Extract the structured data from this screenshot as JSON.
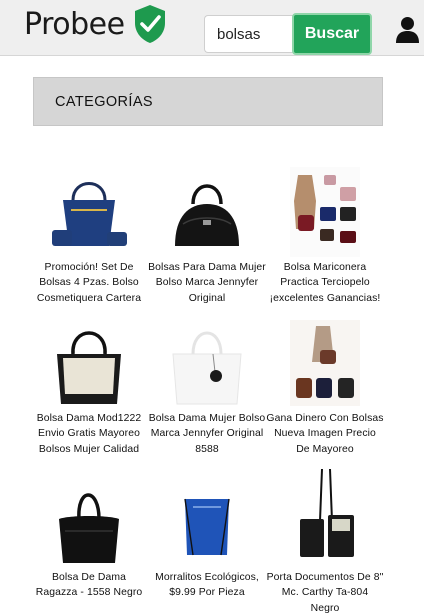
{
  "header": {
    "brand": "Probee",
    "brand_icon": "green-shield-check-icon",
    "search": {
      "value": "bolsas",
      "placeholder": ""
    },
    "search_button": "Buscar",
    "user_icon": "user-icon",
    "colors": {
      "accent": "#22a45a",
      "accent_border": "#8fd6a9",
      "header_bg": "#efefef"
    }
  },
  "categories": {
    "title": "CATEGORÍAS"
  },
  "products": [
    {
      "title": "Promoción! Set De Bolsas 4 Pzas. Bolso Cosmetiquera Cartera",
      "image": "navy-handbag-set"
    },
    {
      "title": "Bolsas Para Dama Mujer Bolso Marca Jennyfer Original",
      "image": "black-dome-handbag"
    },
    {
      "title": "Bolsa Mariconera Practica Terciopelo ¡excelentes Ganancias!",
      "image": "velvet-bags-catalog"
    },
    {
      "title": "Bolsa Dama Mod1222 Envio Gratis Mayoreo Bolsos Mujer Calidad",
      "image": "beige-black-tote"
    },
    {
      "title": "Bolsa Dama Mujer Bolso Marca Jennyfer Original 8588",
      "image": "white-tote-pompom"
    },
    {
      "title": "Gana Dinero Con Bolsas Nueva Imagen Precio De Mayoreo",
      "image": "bags-model-catalog"
    },
    {
      "title": "Bolsa De Dama Ragazza - 1558 Negro",
      "image": "black-shoulder-bag"
    },
    {
      "title": "Morralitos Ecológicos, $9.99 Por Pieza",
      "image": "blue-drawstring-bag"
    },
    {
      "title": "Porta Documentos De 8\" Mc. Carthy Ta-804 Negro",
      "image": "black-document-pouch"
    }
  ]
}
